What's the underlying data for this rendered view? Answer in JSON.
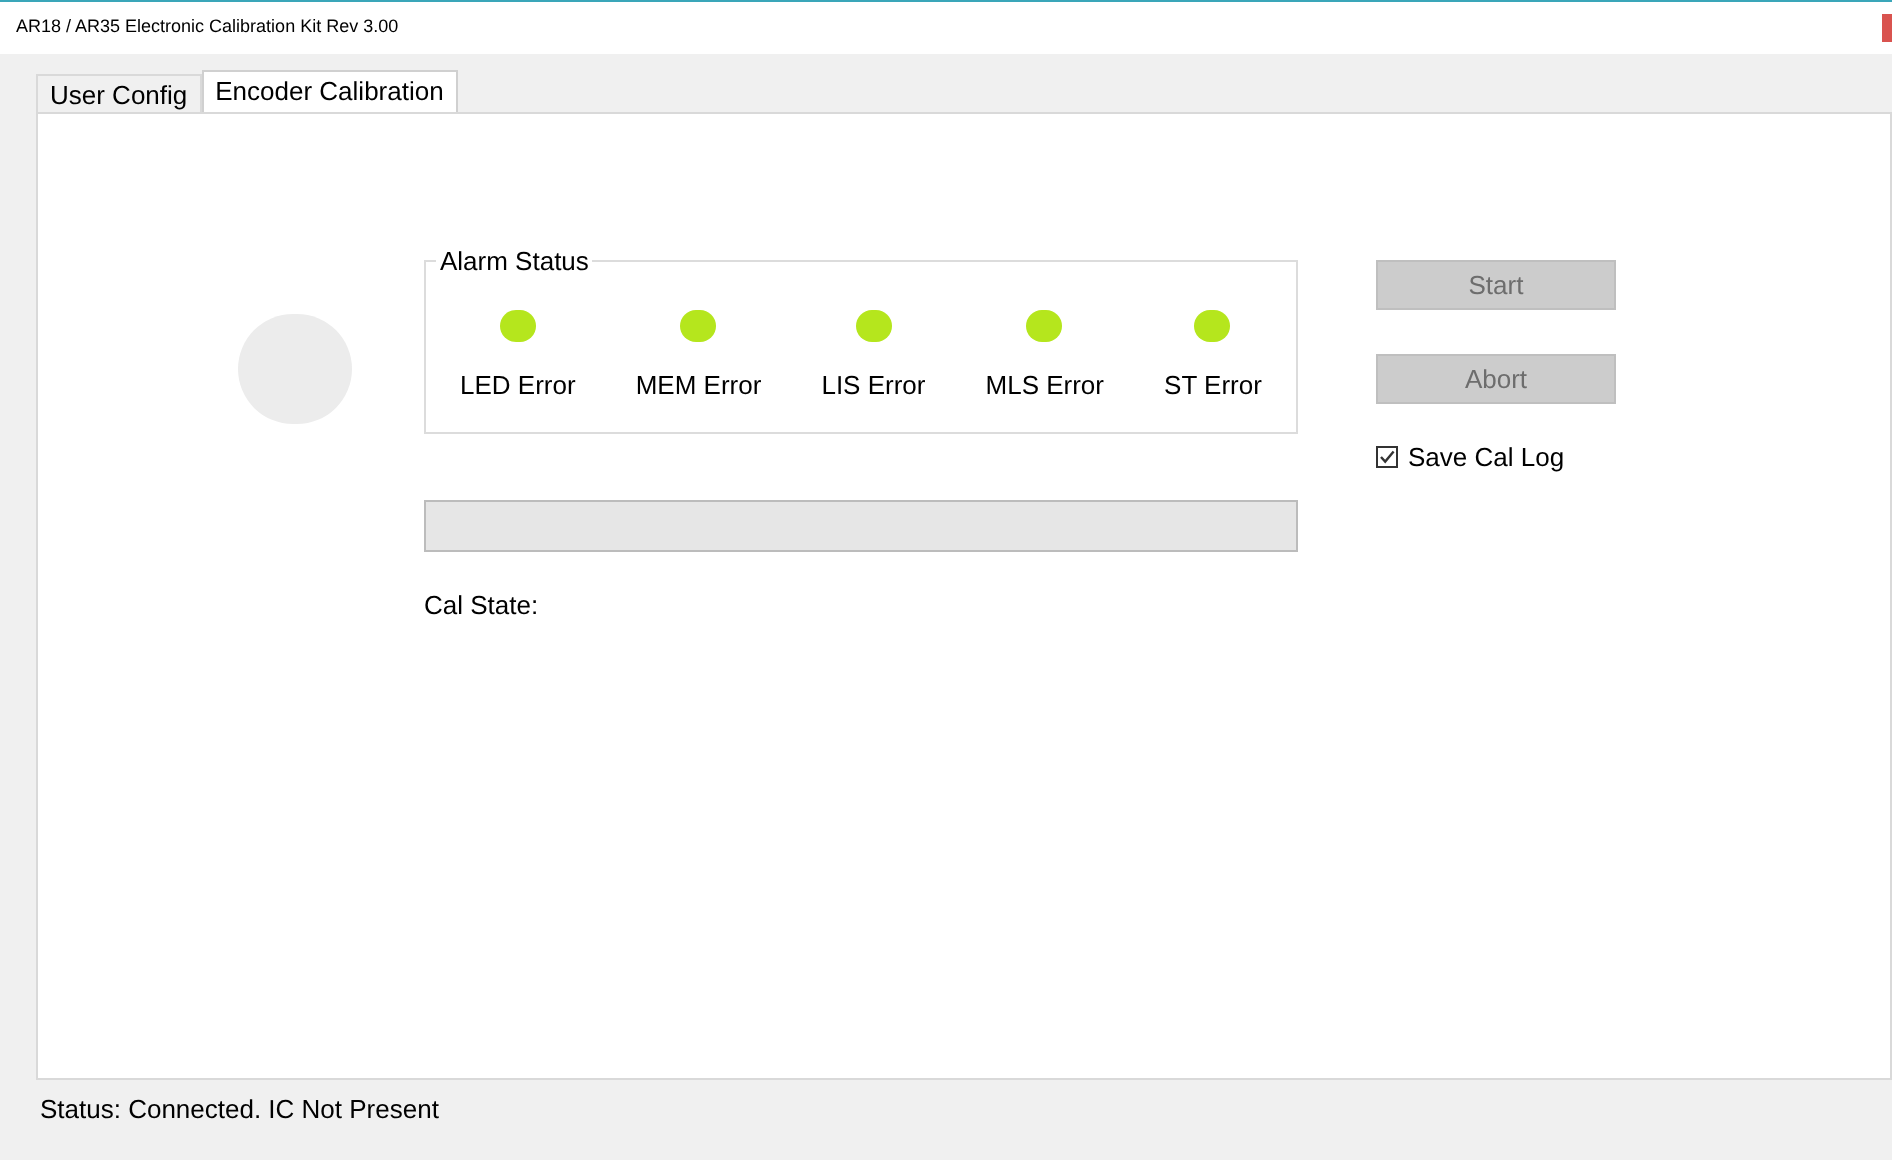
{
  "window": {
    "title": "AR18 / AR35 Electronic Calibration Kit Rev 3.00"
  },
  "tabs": [
    {
      "label": "User Config",
      "selected": false
    },
    {
      "label": "Encoder Calibration",
      "selected": true
    }
  ],
  "alarm_status": {
    "title": "Alarm Status",
    "alarms": [
      {
        "label": "LED Error",
        "color": "#b5e61d"
      },
      {
        "label": "MEM Error",
        "color": "#b5e61d"
      },
      {
        "label": "LIS Error",
        "color": "#b5e61d"
      },
      {
        "label": "MLS Error",
        "color": "#b5e61d"
      },
      {
        "label": "ST Error",
        "color": "#b5e61d"
      }
    ]
  },
  "progress": {
    "level": 0
  },
  "cal_state": "Cal State:",
  "buttons": [
    {
      "label": "Start",
      "disabled": true
    },
    {
      "label": "Abort",
      "disabled": true
    }
  ],
  "save_cal_log": {
    "label": "Save Cal Log",
    "checked": true
  },
  "status_bar": "Status: Connected. IC Not Present"
}
